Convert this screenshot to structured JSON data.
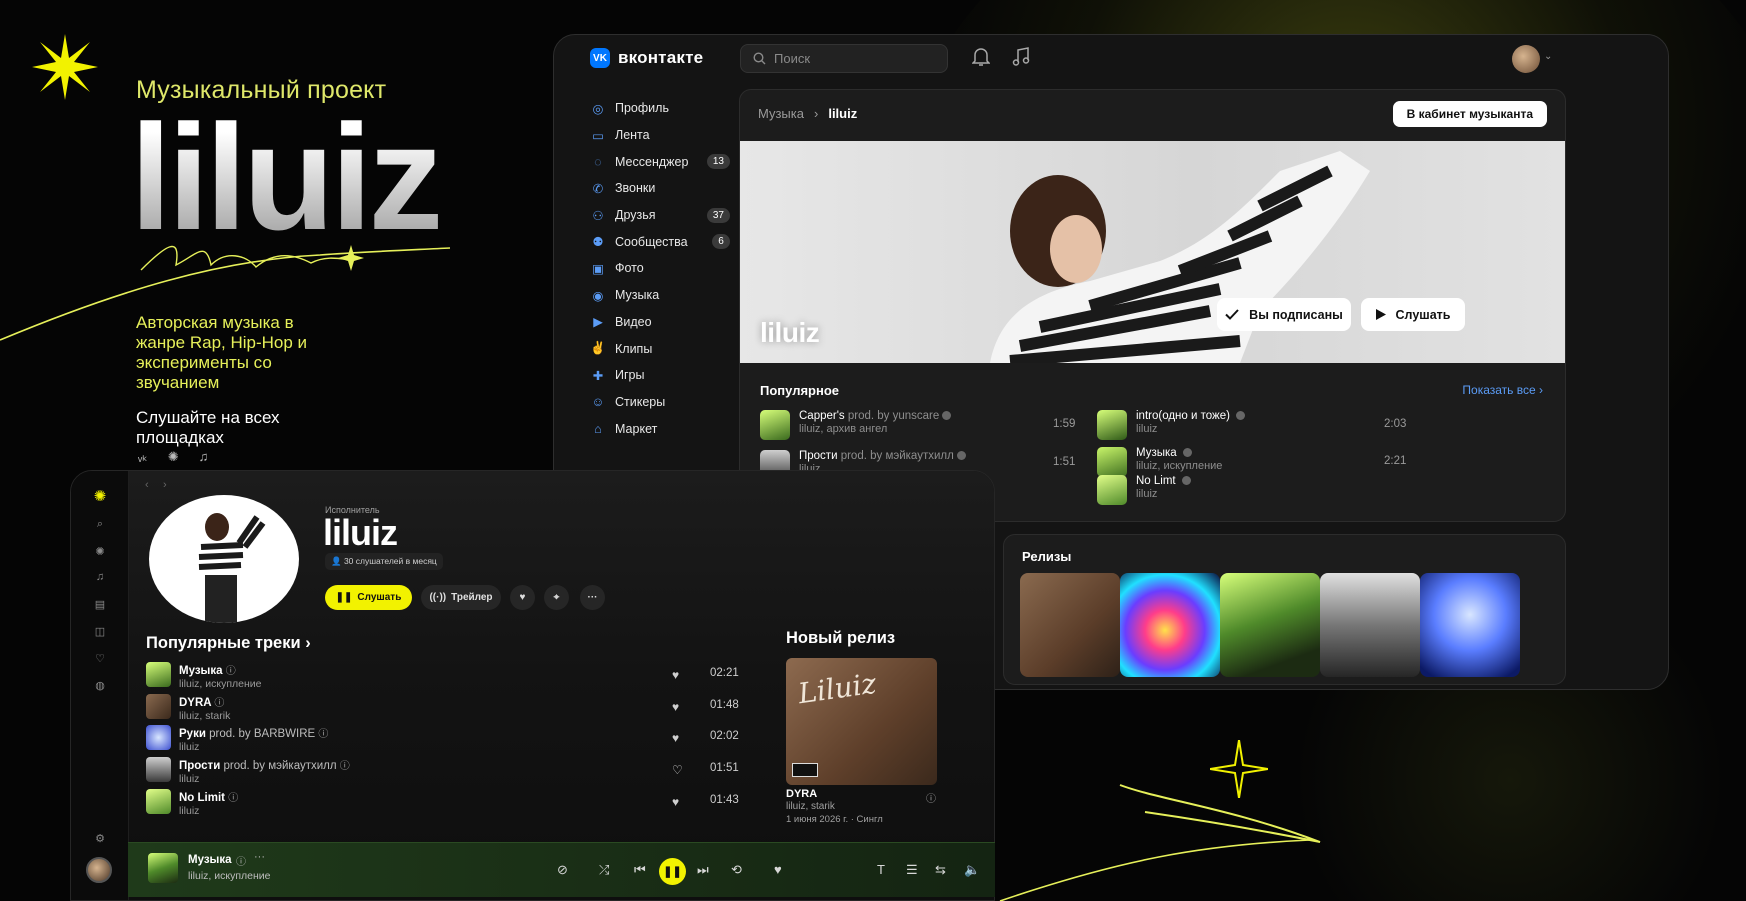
{
  "promo": {
    "subtitle": "Музыкальный проект",
    "title": "liluiz",
    "description": "Авторская музыка в жанре Rap, Hip-Hop и эксперименты со звучанием",
    "listen": "Слушайте на всех площадках",
    "platform_icons": [
      "vk-icon",
      "sparkle-icon",
      "music-note-icon"
    ]
  },
  "vk": {
    "brand": "вконтакте",
    "logo": "VK",
    "search_placeholder": "Поиск",
    "nav": [
      {
        "label": "Профиль",
        "icon": "profile-icon",
        "badge": ""
      },
      {
        "label": "Лента",
        "icon": "feed-icon",
        "badge": ""
      },
      {
        "label": "Мессенджер",
        "icon": "messenger-icon",
        "badge": "13"
      },
      {
        "label": "Звонки",
        "icon": "phone-icon",
        "badge": ""
      },
      {
        "label": "Друзья",
        "icon": "friends-icon",
        "badge": "37"
      },
      {
        "label": "Сообщества",
        "icon": "communities-icon",
        "badge": "6"
      },
      {
        "label": "Фото",
        "icon": "photo-icon",
        "badge": ""
      },
      {
        "label": "Музыка",
        "icon": "music-icon",
        "badge": ""
      },
      {
        "label": "Видео",
        "icon": "video-icon",
        "badge": ""
      },
      {
        "label": "Клипы",
        "icon": "clips-icon",
        "badge": ""
      },
      {
        "label": "Игры",
        "icon": "games-icon",
        "badge": ""
      },
      {
        "label": "Стикеры",
        "icon": "stickers-icon",
        "badge": ""
      },
      {
        "label": "Маркет",
        "icon": "market-icon",
        "badge": ""
      }
    ],
    "breadcrumb": {
      "parent": "Музыка",
      "current": "liluiz"
    },
    "cabinet_button": "В кабинет музыканта",
    "cover_artist": "liluiz",
    "subscribed_button": "Вы подписаны",
    "listen_button": "Слушать",
    "popular_title": "Популярное",
    "show_all": "Показать все",
    "tracks": [
      {
        "title": "Capper's",
        "prod": "prod. by yunscare",
        "artists": "liluiz, архив ангел",
        "duration": "1:59"
      },
      {
        "title": "Прости",
        "prod": "prod. by мэйкаутхилл",
        "artists": "liluiz",
        "duration": "1:51"
      },
      {
        "title": "intro(одно и тоже)",
        "prod": "",
        "artists": "liluiz",
        "duration": "2:03"
      },
      {
        "title": "Музыка",
        "prod": "",
        "artists": "liluiz, искупление",
        "duration": "2:21"
      },
      {
        "title": "No Limt",
        "prod": "",
        "artists": "liluiz",
        "duration": ""
      }
    ],
    "releases_title": "Релизы"
  },
  "player": {
    "artist_label": "Исполнитель",
    "artist_name": "liluiz",
    "listeners": "30 слушателей в месяц",
    "listen_button": "Слушать",
    "trailer_button": "Трейлер",
    "popular_title": "Популярные треки",
    "tracks": [
      {
        "title": "Музыка",
        "prod": "",
        "artists": "liluiz, искупление",
        "duration": "02:21"
      },
      {
        "title": "DYRA",
        "prod": "",
        "artists": "liluiz, starik",
        "duration": "01:48"
      },
      {
        "title": "Руки",
        "prod": "prod. by BARBWIRE",
        "artists": "liluiz",
        "duration": "02:02"
      },
      {
        "title": "Прости",
        "prod": "prod. by мэйкаутхилл",
        "artists": "liluiz",
        "duration": "01:51"
      },
      {
        "title": "No Limit",
        "prod": "",
        "artists": "liluiz",
        "duration": "01:43"
      }
    ],
    "new_release_title": "Новый релиз",
    "new_release": {
      "title": "DYRA",
      "artists": "liluiz, starik",
      "date": "1 июня 2026 г. · Сингл",
      "cover_text": "Liluiz"
    },
    "now_playing": {
      "title": "Музыка",
      "artists": "liluiz, искупление"
    }
  },
  "colors": {
    "accent": "#f2f200",
    "vk_blue": "#0077ff",
    "background": "#050505",
    "player_bar": "#1f3a1a"
  }
}
